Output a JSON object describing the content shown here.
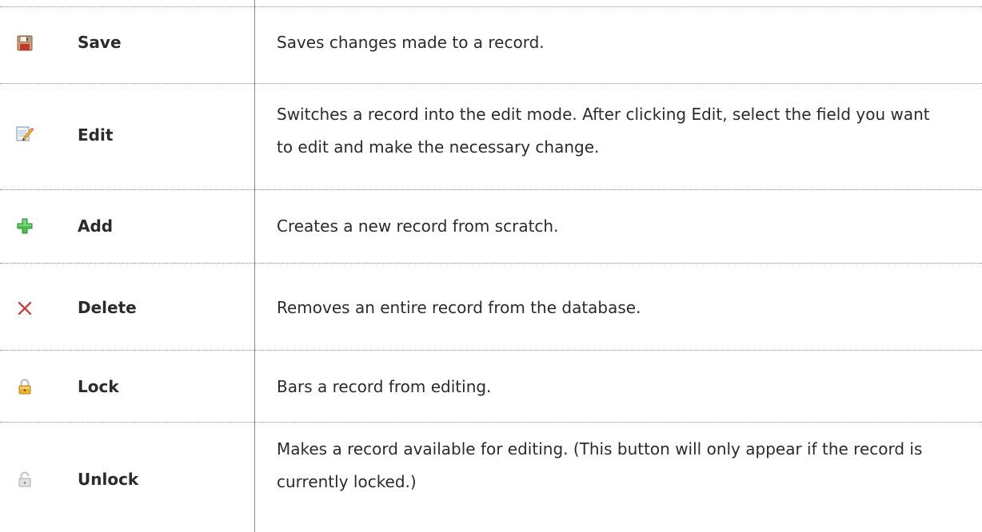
{
  "colors": {
    "divider": "#8a8a8a",
    "text": "#2b2b2b",
    "save_icon": "#c0392b",
    "add_icon": "#3cb043",
    "delete_icon": "#d32f2f",
    "lock_icon": "#d4a520",
    "unlock_icon": "#bdbdbd"
  },
  "rows": [
    {
      "icon": "save-icon",
      "name": "Save",
      "description": "Saves changes made to a record."
    },
    {
      "icon": "edit-icon",
      "name": "Edit",
      "description": "Switches a record into the edit mode. After clicking Edit, select the field you want to edit and make the necessary change."
    },
    {
      "icon": "add-icon",
      "name": "Add",
      "description": "Creates a new record from scratch."
    },
    {
      "icon": "delete-icon",
      "name": "Delete",
      "description": "Removes an entire record from the database."
    },
    {
      "icon": "lock-icon",
      "name": "Lock",
      "description": "Bars a record from editing."
    },
    {
      "icon": "unlock-icon",
      "name": "Unlock",
      "description": "Makes a record available for editing. (This button will only appear if the record is currently locked.)"
    }
  ]
}
